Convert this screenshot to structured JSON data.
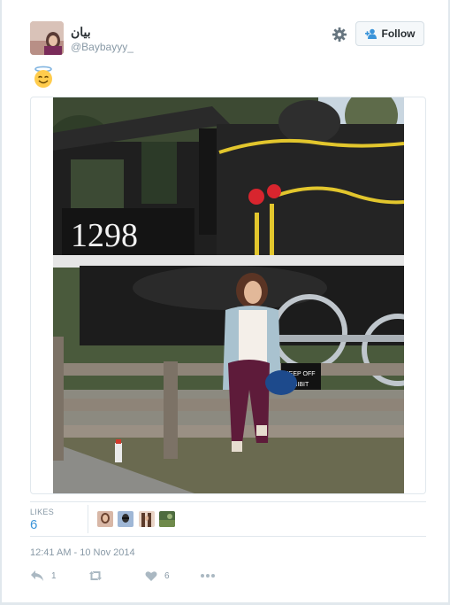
{
  "header": {
    "display_name": "بيان",
    "screen_name": "@Baybayyy_",
    "follow_label": "Follow"
  },
  "tweet": {
    "icons": [
      "smiling-face-with-halo-emoji"
    ]
  },
  "stats": {
    "likes_label": "LIKES",
    "likes_count": "6"
  },
  "timestamp": "12:41 AM - 10 Nov 2014",
  "actions": {
    "reply_count": "1",
    "like_count": "6"
  },
  "colors": {
    "link_blue": "#3b94d9",
    "muted_gray": "#8899a6",
    "border": "#e1e8ed"
  }
}
